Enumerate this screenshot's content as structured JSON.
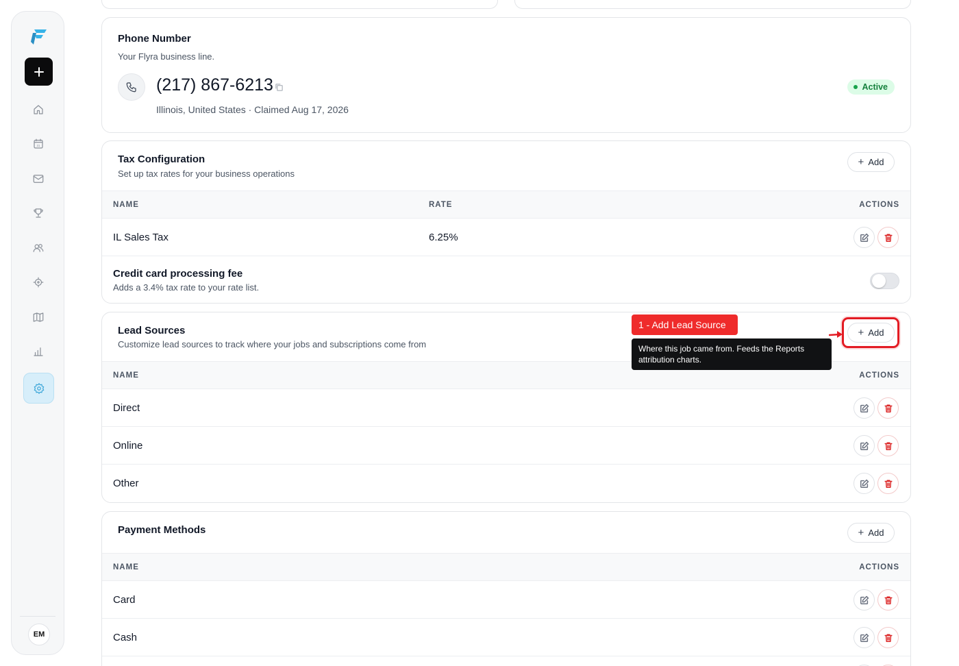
{
  "sidebar": {
    "nav": [
      "home-icon",
      "calendar-icon",
      "mail-icon",
      "trophy-icon",
      "users-icon",
      "target-icon",
      "map-icon",
      "chart-icon",
      "settings-icon"
    ],
    "calendar_day": "31",
    "avatar": "EM",
    "brand_color": "#3aa5d8"
  },
  "phone": {
    "title": "Phone Number",
    "subtitle": "Your Flyra business line.",
    "number": "(217) 867-6213",
    "meta": "Illinois, United States · Claimed Aug 17, 2026",
    "status": "Active"
  },
  "tax": {
    "title": "Tax Configuration",
    "subtitle": "Set up tax rates for your business operations",
    "add_label": "Add",
    "columns": [
      "NAME",
      "RATE",
      "ACTIONS"
    ],
    "rows": [
      {
        "name": "IL Sales Tax",
        "rate": "6.25%"
      }
    ],
    "fee_title": "Credit card processing fee",
    "fee_desc": "Adds a 3.4% tax rate to your rate list.",
    "fee_enabled": false
  },
  "lead_sources": {
    "title": "Lead Sources",
    "subtitle": "Customize lead sources to track where your jobs and subscriptions come from",
    "add_label": "Add",
    "columns": [
      "NAME",
      "ACTIONS"
    ],
    "rows": [
      "Direct",
      "Online",
      "Other"
    ]
  },
  "payment_methods": {
    "title": "Payment Methods",
    "add_label": "Add",
    "columns": [
      "NAME",
      "ACTIONS"
    ],
    "rows": [
      "Card",
      "Cash"
    ]
  },
  "tour": {
    "step_label": "1 - Add Lead Source",
    "tooltip": "Where this job came from. Feeds the Reports attribution charts.",
    "highlight_color": "#e31b23"
  }
}
